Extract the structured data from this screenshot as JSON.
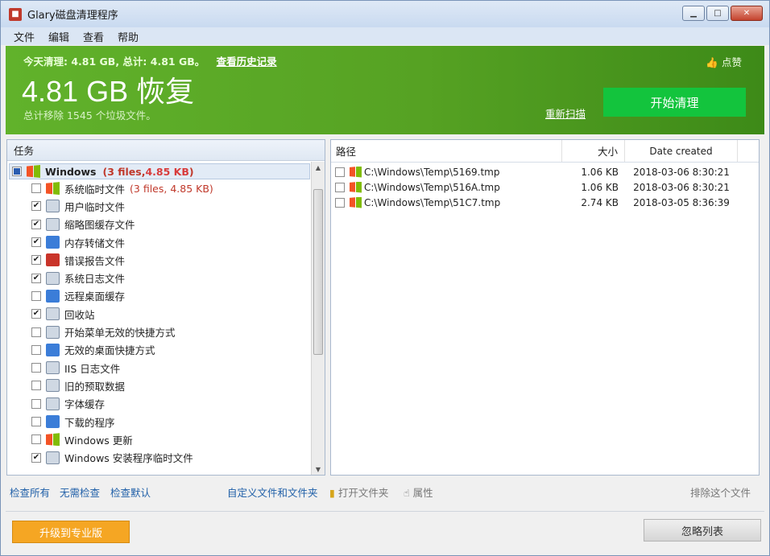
{
  "window": {
    "title": "Glary磁盘清理程序"
  },
  "menu": [
    "文件",
    "编辑",
    "查看",
    "帮助"
  ],
  "hero": {
    "today_text": "今天清理: 4.81 GB, 总计: 4.81 GB。",
    "history_link": "查看历史记录",
    "big_amount": "4.81 GB 恢复",
    "summary": "总计移除 1545 个垃圾文件。",
    "like_label": "点赞",
    "rescan": "重新扫描",
    "start_button": "开始清理",
    "colors": {
      "bar": "#56a223",
      "start": "#13c43d"
    }
  },
  "tasks": {
    "header": "任务",
    "group": {
      "name": "Windows",
      "meta_files": "(3 files, ",
      "meta_size": "4.85 KB",
      "meta_close": ")"
    },
    "items": [
      {
        "label": "系统临时文件",
        "checked": false,
        "meta": "(3 files, 4.85 KB)"
      },
      {
        "label": "用户临时文件",
        "checked": true
      },
      {
        "label": "缩略图缓存文件",
        "checked": true
      },
      {
        "label": "内存转储文件",
        "checked": true
      },
      {
        "label": "错误报告文件",
        "checked": true
      },
      {
        "label": "系统日志文件",
        "checked": true
      },
      {
        "label": "远程桌面缓存",
        "checked": false
      },
      {
        "label": "回收站",
        "checked": true
      },
      {
        "label": "开始菜单无效的快捷方式",
        "checked": false
      },
      {
        "label": "无效的桌面快捷方式",
        "checked": false
      },
      {
        "label": "IIS 日志文件",
        "checked": false
      },
      {
        "label": "旧的预取数据",
        "checked": false
      },
      {
        "label": "字体缓存",
        "checked": false
      },
      {
        "label": "下载的程序",
        "checked": false
      },
      {
        "label": "Windows 更新",
        "checked": false
      },
      {
        "label": "Windows 安装程序临时文件",
        "checked": true
      }
    ]
  },
  "files": {
    "columns": {
      "path": "路径",
      "size": "大小",
      "date": "Date created"
    },
    "rows": [
      {
        "path": "C:\\Windows\\Temp\\5169.tmp",
        "size": "1.06 KB",
        "date": "2018-03-06 8:30:21"
      },
      {
        "path": "C:\\Windows\\Temp\\516A.tmp",
        "size": "1.06 KB",
        "date": "2018-03-06 8:30:21"
      },
      {
        "path": "C:\\Windows\\Temp\\51C7.tmp",
        "size": "2.74 KB",
        "date": "2018-03-05 8:36:39"
      }
    ]
  },
  "links": {
    "check_all": "检查所有",
    "check_none": "无需检查",
    "check_default": "检查默认",
    "custom": "自定义文件和文件夹",
    "open_folder": "打开文件夹",
    "properties": "属性",
    "exclude": "排除这个文件"
  },
  "footer": {
    "upgrade": "升级到专业版",
    "ignore": "忽略列表"
  }
}
